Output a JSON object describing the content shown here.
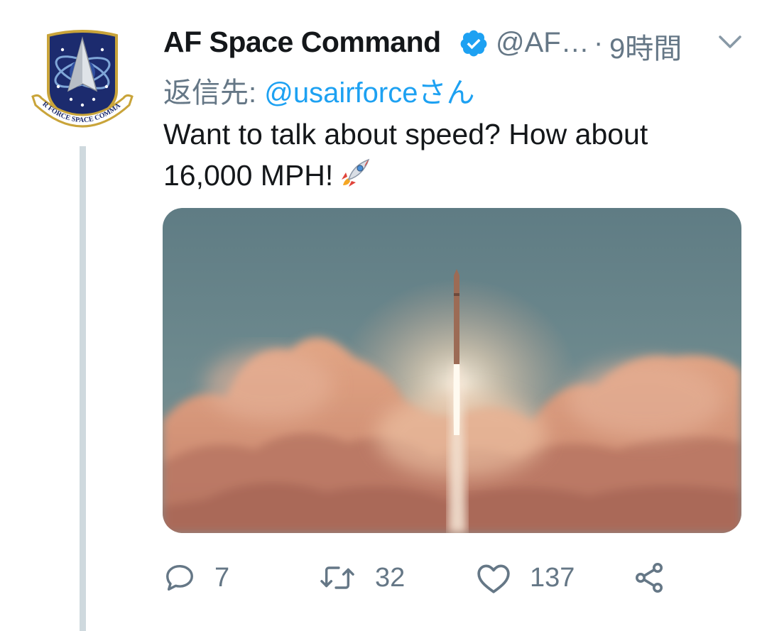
{
  "tweet": {
    "author_name": "AF Space Command",
    "author_handle": "@AF…",
    "separator": "·",
    "timestamp": "9時間",
    "reply_prefix": "返信先: ",
    "reply_mention": "@usairforceさん",
    "text_line1": "Want to talk about speed? How about",
    "text_line2": "16,000 MPH!",
    "text_emoji": "rocket-icon",
    "avatar_emblem_text": "AIR FORCE SPACE COMMAND"
  },
  "actions": {
    "reply_count": "7",
    "retweet_count": "32",
    "like_count": "137"
  },
  "icons": {
    "reply": "reply-icon",
    "retweet": "retweet-icon",
    "like": "heart-icon",
    "share": "share-icon",
    "menu": "chevron-down-icon",
    "verified": "verified-badge-icon"
  },
  "colors": {
    "text": "#14171a",
    "secondary": "#657786",
    "link": "#1da1f2",
    "thread_line": "#cfd9de"
  }
}
